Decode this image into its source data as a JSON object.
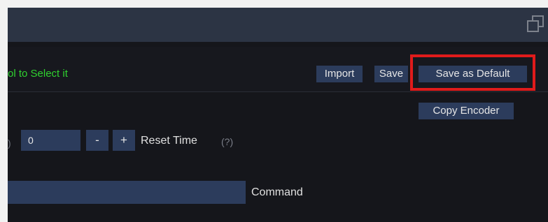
{
  "header": {
    "hint_text": "ol to Select it",
    "buttons": {
      "import": "Import",
      "save": "Save",
      "save_as_default": "Save as Default",
      "copy_encoder": "Copy Encoder"
    },
    "restore_icon": "restore-window-icon"
  },
  "reset_time": {
    "paren_fragment": ")",
    "value": "0",
    "minus_label": "-",
    "plus_label": "+",
    "label": "Reset Time",
    "help": "(?)"
  },
  "command": {
    "value": "",
    "label": "Command"
  },
  "colors": {
    "background": "#15161b",
    "titlebar": "#2c3444",
    "button": "#2c3c5c",
    "hint_green": "#2fd22f",
    "highlight_red": "#e01b1b",
    "text": "#e0e0e0"
  }
}
